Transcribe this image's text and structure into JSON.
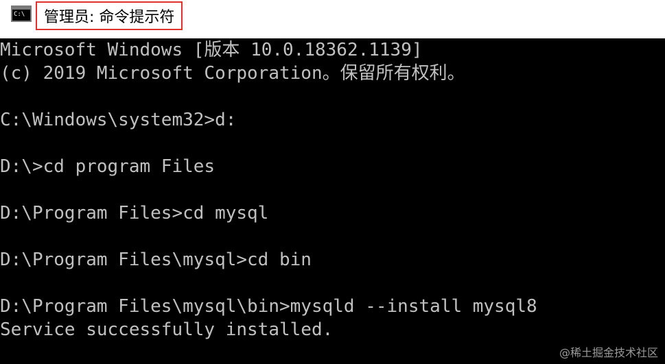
{
  "window": {
    "icon_label": "C:\\",
    "title": "管理员: 命令提示符"
  },
  "console": {
    "lines": [
      "Microsoft Windows [版本 10.0.18362.1139]",
      "(c) 2019 Microsoft Corporation。保留所有权利。",
      "",
      "C:\\Windows\\system32>d:",
      "",
      "D:\\>cd program Files",
      "",
      "D:\\Program Files>cd mysql",
      "",
      "D:\\Program Files\\mysql>cd bin",
      "",
      "D:\\Program Files\\mysql\\bin>mysqld --install mysql8",
      "Service successfully installed."
    ]
  },
  "watermark": "@稀土掘金技术社区",
  "colors": {
    "titlebar_bg": "#ffffff",
    "console_bg": "#000000",
    "console_text": "#c0c0c0",
    "highlight_border": "#e0322d"
  }
}
